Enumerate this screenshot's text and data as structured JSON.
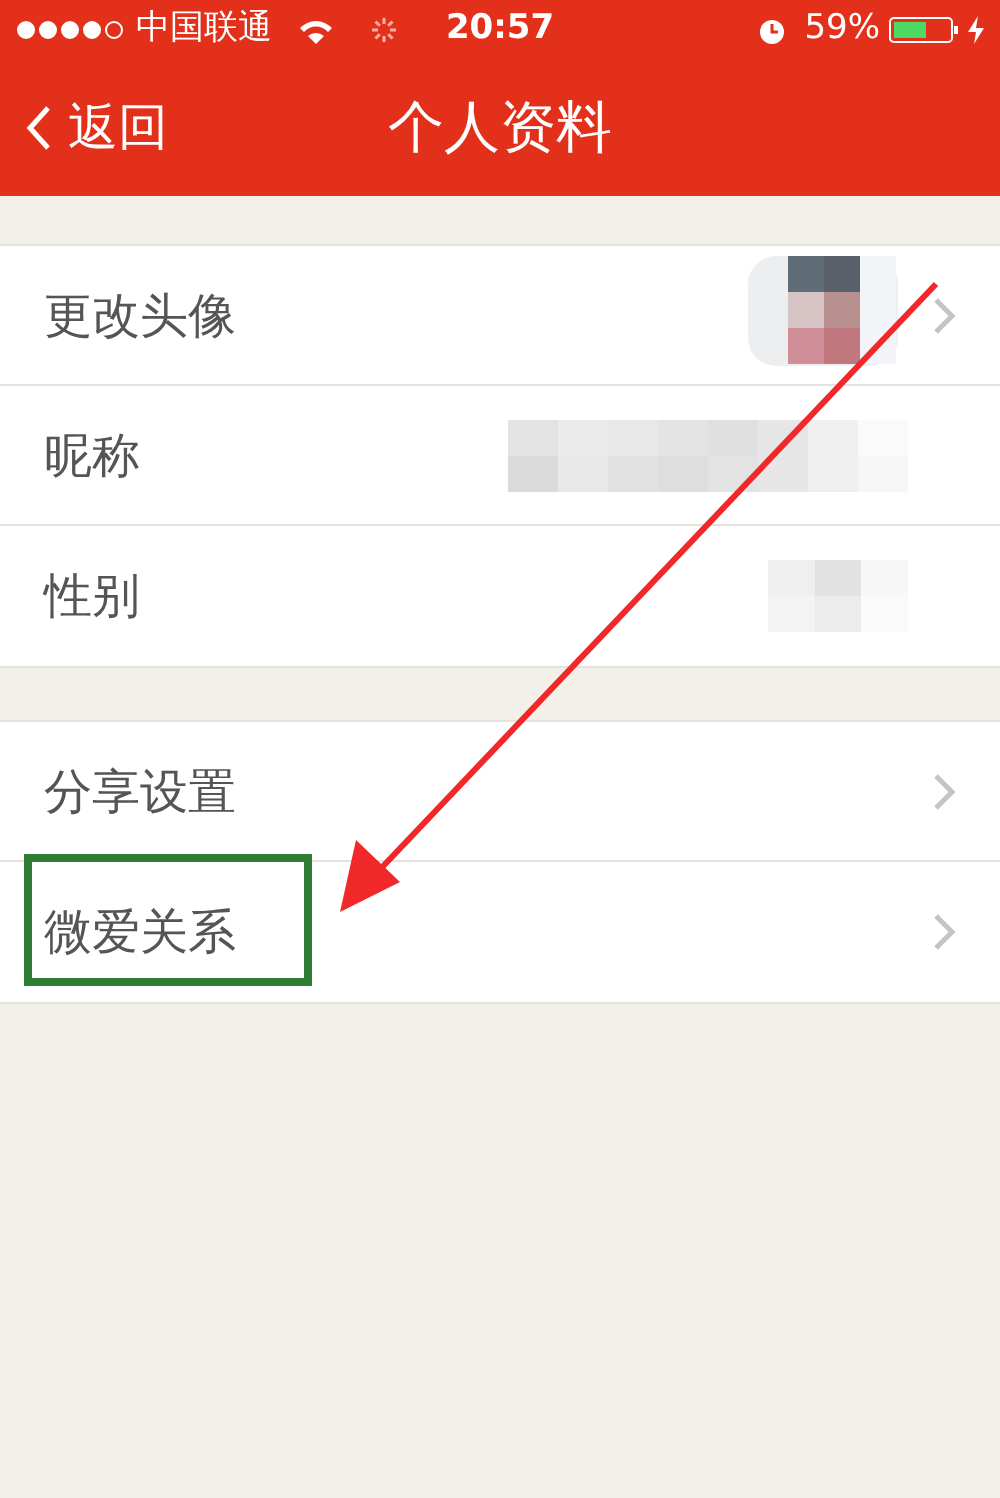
{
  "status_bar": {
    "carrier": "中国联通",
    "time": "20:57",
    "battery": "59%"
  },
  "nav_bar": {
    "back": "返回",
    "title": "个人资料"
  },
  "sections": [
    {
      "rows": [
        {
          "label": "更改头像",
          "kind": "avatar",
          "chevron": true
        },
        {
          "label": "昵称",
          "kind": "masked",
          "chevron": false
        },
        {
          "label": "性别",
          "kind": "masked_small",
          "chevron": false
        }
      ]
    },
    {
      "rows": [
        {
          "label": "分享设置",
          "kind": "plain",
          "chevron": true
        },
        {
          "label": "微爱关系",
          "kind": "plain",
          "chevron": true
        }
      ]
    }
  ]
}
